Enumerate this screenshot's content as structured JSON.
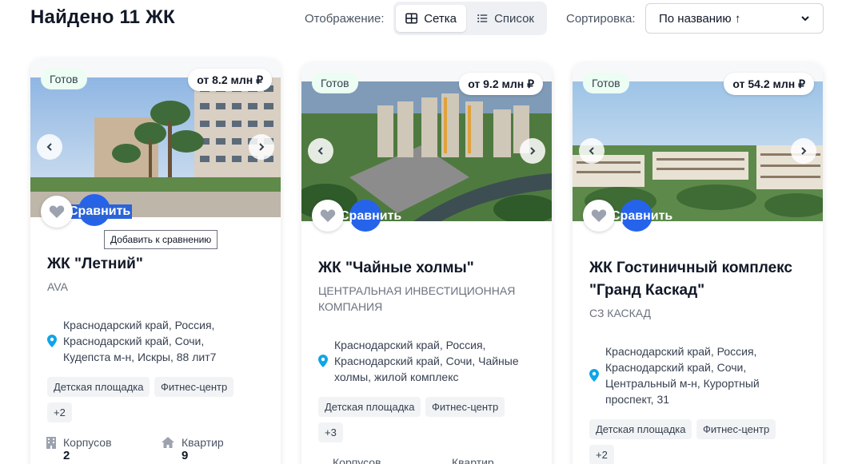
{
  "header": {
    "title": "Найдено 11 ЖК",
    "view_label": "Отображение:",
    "grid_label": "Сетка",
    "list_label": "Список",
    "sort_label": "Сортировка:",
    "sort_value": "По названию ↑"
  },
  "tooltip": "Добавить к сравнению",
  "cards": [
    {
      "badge": "Готов",
      "price": "от 8.2 млн ₽",
      "compare": "Сравнить",
      "title_lines": [
        "ЖК \"Летний\""
      ],
      "developer_lines": [
        "AVA"
      ],
      "address_lines": [
        "Краснодарский край, Россия,",
        "Краснодарский край, Сочи,",
        "Кудепста м-н, Искры, 88 лит7"
      ],
      "tags": [
        "Детская площадка",
        "Фитнес-центр",
        "+2"
      ],
      "stats": [
        {
          "label": "Корпусов",
          "value": "2",
          "icon": "building-icon"
        },
        {
          "label": "Квартир",
          "value": "9",
          "icon": "home-icon"
        }
      ]
    },
    {
      "badge": "Готов",
      "price": "от 9.2 млн ₽",
      "compare": "Сравнить",
      "title_lines": [
        "ЖК \"Чайные холмы\""
      ],
      "developer_lines": [
        "ЦЕНТРАЛЬНАЯ ИНВЕСТИЦИОННАЯ",
        "КОМПАНИЯ"
      ],
      "address_lines": [
        "Краснодарский край, Россия,",
        "Краснодарский край, Сочи, Чайные",
        "холмы, жилой комплекс"
      ],
      "tags": [
        "Детская площадка",
        "Фитнес-центр",
        "+3"
      ],
      "stats": [
        {
          "label": "Корпусов",
          "value": "",
          "icon": "building-icon"
        },
        {
          "label": "Квартир",
          "value": "",
          "icon": "home-icon"
        }
      ]
    },
    {
      "badge": "Готов",
      "price": "от 54.2 млн ₽",
      "compare": "Сравнить",
      "title_lines": [
        "ЖК Гостиничный комплекс",
        "\"Гранд Каскад\""
      ],
      "developer_lines": [
        "СЗ КАСКАД"
      ],
      "address_lines": [
        "Краснодарский край, Россия,",
        "Краснодарский край, Сочи,",
        "Центральный м-н, Курортный",
        "проспект, 31"
      ],
      "tags": [
        "Детская площадка",
        "Фитнес-центр",
        "+2"
      ],
      "stats": []
    }
  ],
  "colors": {
    "accent": "#2563eb",
    "pin": "#0ea5e9",
    "badge_bg": "#ecfdf3"
  }
}
